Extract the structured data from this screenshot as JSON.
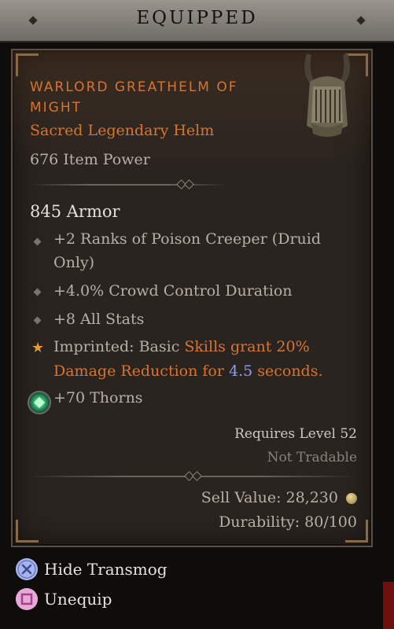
{
  "header": {
    "title": "EQUIPPED"
  },
  "item": {
    "name": "WARLORD GREATHELM OF MIGHT",
    "type": "Sacred Legendary Helm",
    "power": "676 Item Power",
    "armor": "845 Armor",
    "affixes": [
      "+2 Ranks of Poison Creeper (Druid",
      "Only)",
      "+4.0% Crowd Control Duration",
      "+8 All Stats"
    ],
    "aspect": {
      "prefix": "Imprinted:",
      "part1": "Basic",
      "part2": "Skills grant 20%",
      "part3": "Damage Reduction for",
      "value": "4.5",
      "part4": "seconds."
    },
    "socket_bonus": "+70 Thorns",
    "requires": "Requires Level 52",
    "tradable": "Not Tradable",
    "sell_value": "Sell Value: 28,230",
    "durability": "Durability: 80/100"
  },
  "actions": {
    "hide_transmog": "Hide Transmog",
    "unequip": "Unequip"
  },
  "colors": {
    "legendary_orange": "#d9742c",
    "value_blue": "#8a9df0",
    "header_bg": "#8f8a84",
    "card_bg": "#2a2420"
  },
  "icons": [
    "diamond-ornament-icon",
    "helm-item-icon",
    "star-icon",
    "emerald-gem-icon",
    "gold-coin-icon",
    "cross-button-icon",
    "square-button-icon"
  ]
}
